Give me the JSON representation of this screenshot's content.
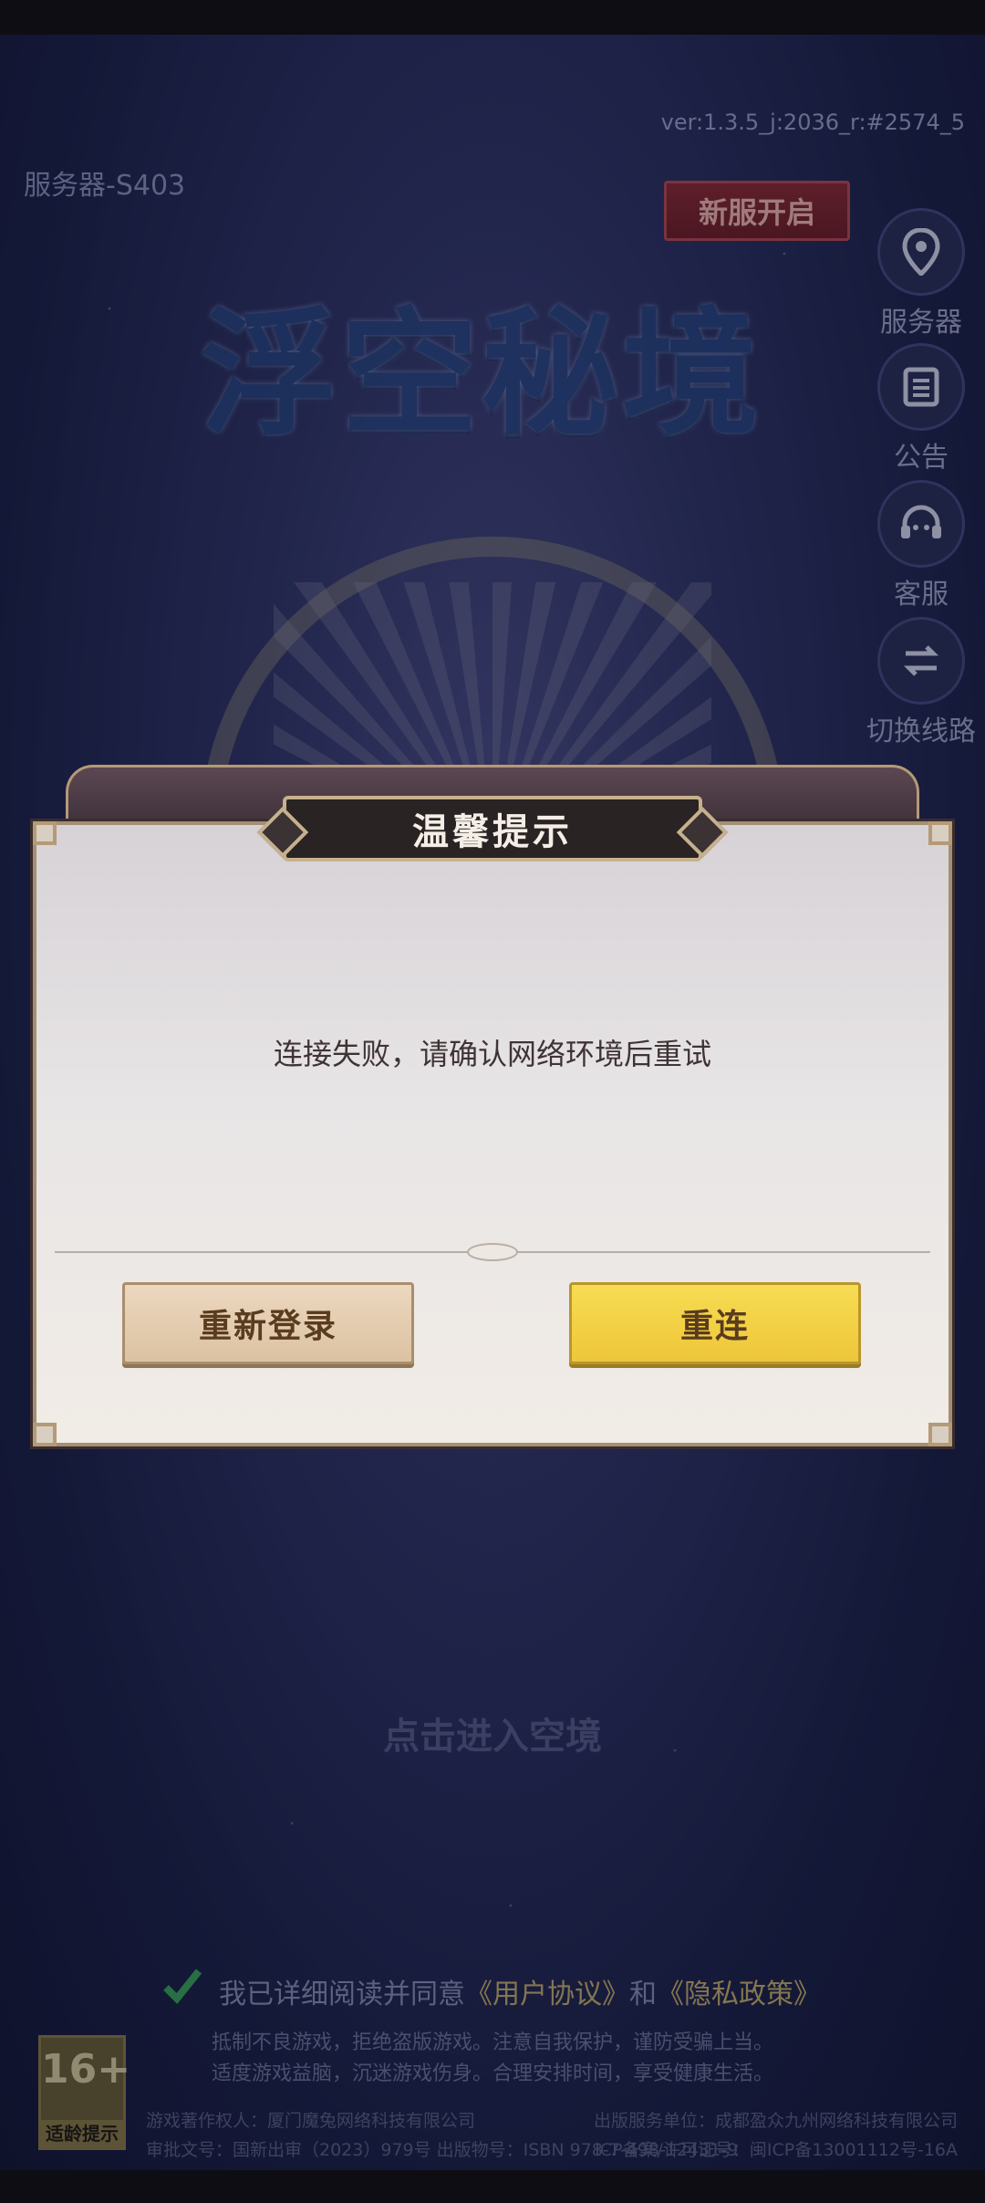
{
  "header": {
    "version": "ver:1.3.5_j:2036_r:#2574_5",
    "server": "服务器-S403",
    "new_server": "新服开启"
  },
  "logo_text": "浮空秘境",
  "side_menu": [
    {
      "icon": "location-pin-icon",
      "label": "服务器"
    },
    {
      "icon": "notice-list-icon",
      "label": "公告"
    },
    {
      "icon": "headset-icon",
      "label": "客服"
    },
    {
      "icon": "switch-route-icon",
      "label": "切换线路"
    }
  ],
  "dialog": {
    "title": "温馨提示",
    "message": "连接失败，请确认网络环境后重试",
    "relogin_label": "重新登录",
    "reconnect_label": "重连"
  },
  "enter_label": "点击进入空境",
  "agreement": {
    "prefix": "我已详细阅读并同意",
    "user_agreement": "《用户协议》",
    "and": "和",
    "privacy_policy": "《隐私政策》"
  },
  "health_notice": {
    "line1": "抵制不良游戏，拒绝盗版游戏。注意自我保护，谨防受骗上当。",
    "line2": "适度游戏益脑，沉迷游戏伤身。合理安排时间，享受健康生活。"
  },
  "age_rating": {
    "number": "16+",
    "caption": "适龄提示"
  },
  "footer": {
    "copyright_owner": "游戏著作权人：厦门魔兔网络科技有限公司",
    "approval": "审批文号：国新出审（2023）979号  出版物号：ISBN 978-7-498-12431-9",
    "publisher": "出版服务单位：成都盈众九州网络科技有限公司",
    "icp": "ICP备案/许可证号：闽ICP备13001112号-16A"
  },
  "colors": {
    "reconnect_button": "#F3D046",
    "relogin_button": "#E6CFB2",
    "new_server_badge": "#7D232C"
  }
}
